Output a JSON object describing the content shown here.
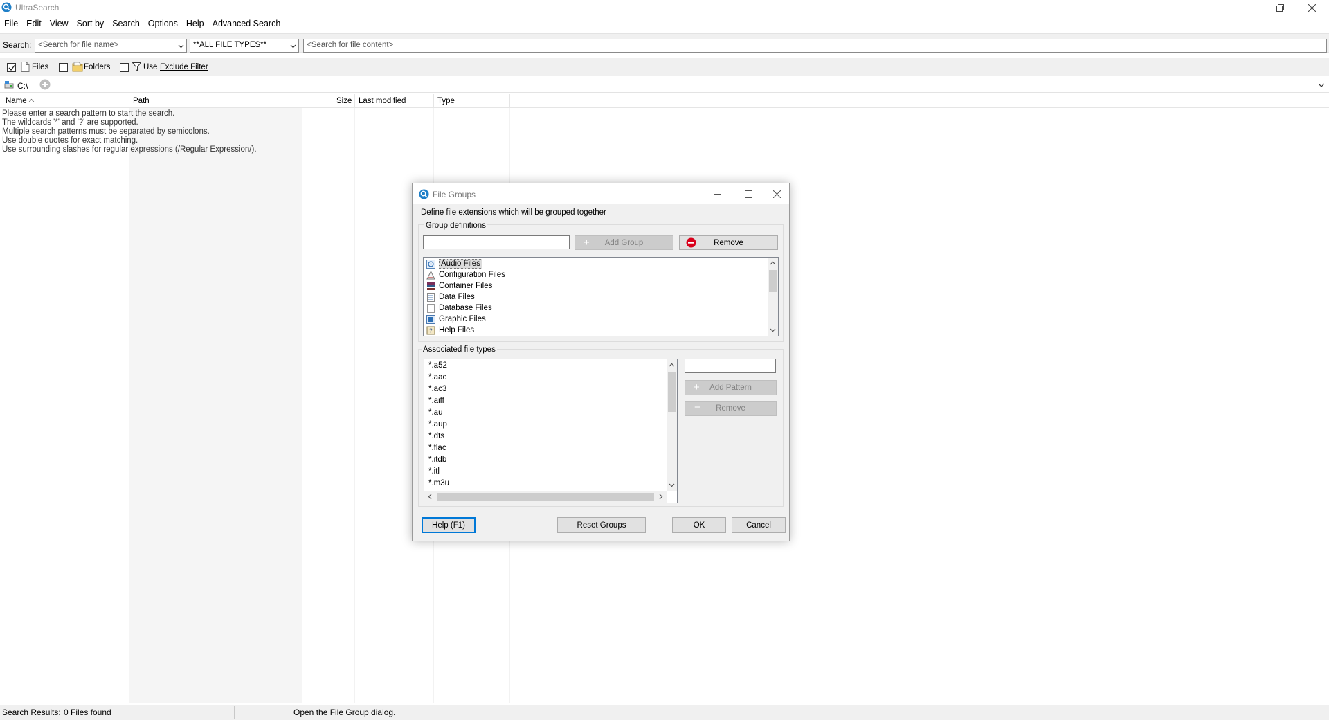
{
  "app": {
    "title": "UltraSearch"
  },
  "menu": [
    "File",
    "Edit",
    "View",
    "Sort by",
    "Search",
    "Options",
    "Help",
    "Advanced Search"
  ],
  "search": {
    "label": "Search:",
    "name_placeholder": "<Search for file name>",
    "file_type_value": "**ALL FILE TYPES**",
    "content_placeholder": "<Search for file content>"
  },
  "filters": {
    "files_label": "Files",
    "files_checked": true,
    "folders_label": "Folders",
    "folders_checked": false,
    "use_label": "Use",
    "exclude_filter_link": "Exclude Filter",
    "use_checked": false
  },
  "path_bar": {
    "drive": "C:\\"
  },
  "columns": {
    "name": "Name",
    "path": "Path",
    "size": "Size",
    "last_modified": "Last modified",
    "type": "Type"
  },
  "hints": [
    "Please enter a search pattern to start the search.",
    "The wildcards '*' and '?' are supported.",
    "Multiple search patterns must be separated by semicolons.",
    "Use double quotes for exact matching.",
    "Use surrounding slashes for regular expressions (/Regular Expression/)."
  ],
  "status": {
    "results_label": "Search Results:",
    "results_value": "0 Files found",
    "message": "Open the File Group dialog."
  },
  "dialog": {
    "title": "File Groups",
    "description": "Define file extensions which will be grouped together",
    "group_definitions_label": "Group definitions",
    "add_group_label": "Add Group",
    "remove_group_label": "Remove",
    "groups": [
      {
        "label": "Audio Files",
        "icon": "audio-file-icon",
        "selected": true
      },
      {
        "label": "Configuration Files",
        "icon": "configuration-file-icon"
      },
      {
        "label": "Container Files",
        "icon": "container-file-icon"
      },
      {
        "label": "Data Files",
        "icon": "data-file-icon"
      },
      {
        "label": "Database Files",
        "icon": "database-file-icon"
      },
      {
        "label": "Graphic Files",
        "icon": "graphic-file-icon"
      },
      {
        "label": "Help Files",
        "icon": "help-file-icon"
      }
    ],
    "associated_label": "Associated file types",
    "file_types": [
      "*.a52",
      "*.aac",
      "*.ac3",
      "*.aiff",
      "*.au",
      "*.aup",
      "*.dts",
      "*.flac",
      "*.itdb",
      "*.itl",
      "*.m3u"
    ],
    "add_pattern_label": "Add Pattern",
    "remove_pattern_label": "Remove",
    "help_label": "Help (F1)",
    "reset_label": "Reset Groups",
    "ok_label": "OK",
    "cancel_label": "Cancel"
  },
  "colors": {
    "accent": "#0078d7",
    "remove_red": "#d9001b",
    "link_blue": "#0033cc"
  }
}
